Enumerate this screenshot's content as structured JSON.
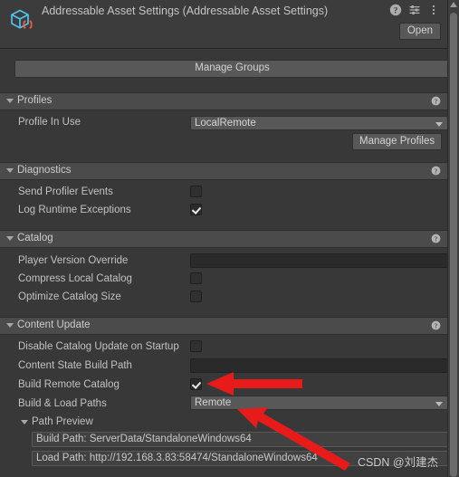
{
  "header": {
    "title": "Addressable Asset Settings (Addressable Asset Settings)",
    "icon": "addressable-asset-cube-icon",
    "help_icon": "help-icon",
    "preset_icon": "preset-sliders-icon",
    "menu_icon": "kebab-menu-icon",
    "open_label": "Open"
  },
  "toolbar": {
    "manage_groups_label": "Manage Groups"
  },
  "sections": {
    "profiles": {
      "title": "Profiles",
      "help_icon": "help-icon",
      "profile_in_use_label": "Profile In Use",
      "profile_in_use_value": "LocalRemote",
      "manage_profiles_label": "Manage Profiles"
    },
    "diagnostics": {
      "title": "Diagnostics",
      "help_icon": "help-icon",
      "send_profiler_events_label": "Send Profiler Events",
      "send_profiler_events_checked": false,
      "log_runtime_exceptions_label": "Log Runtime Exceptions",
      "log_runtime_exceptions_checked": true
    },
    "catalog": {
      "title": "Catalog",
      "help_icon": "help-icon",
      "player_version_override_label": "Player Version Override",
      "player_version_override_value": "",
      "compress_local_catalog_label": "Compress Local Catalog",
      "compress_local_catalog_checked": false,
      "optimize_catalog_size_label": "Optimize Catalog Size",
      "optimize_catalog_size_checked": false
    },
    "content_update": {
      "title": "Content Update",
      "help_icon": "help-icon",
      "disable_catalog_update_label": "Disable Catalog Update on Startup",
      "disable_catalog_update_checked": false,
      "content_state_build_path_label": "Content State Build Path",
      "content_state_build_path_value": "",
      "build_remote_catalog_label": "Build Remote Catalog",
      "build_remote_catalog_checked": true,
      "build_load_paths_label": "Build & Load Paths",
      "build_load_paths_value": "Remote",
      "path_preview": {
        "title": "Path Preview",
        "build_path": "Build Path: ServerData/StandaloneWindows64",
        "load_path": "Load Path: http://192.168.3.83:58474/StandaloneWindows64"
      }
    }
  },
  "annotations": {
    "arrow_color": "#e81b1b",
    "arrow_1_target": "build-remote-catalog-checkbox",
    "arrow_2_target": "build-load-paths-dropdown"
  },
  "watermark": {
    "text": "CSDN @刘建杰"
  },
  "scrollbar": {
    "name": "vertical-scrollbar"
  },
  "colors": {
    "background": "#383838",
    "section_header": "#4b4b4b",
    "button": "#585858",
    "field": "#2a2a2a",
    "text": "#c2c2c2",
    "icon_blue": "#4ec3ec",
    "icon_orange": "#f05a3c"
  }
}
